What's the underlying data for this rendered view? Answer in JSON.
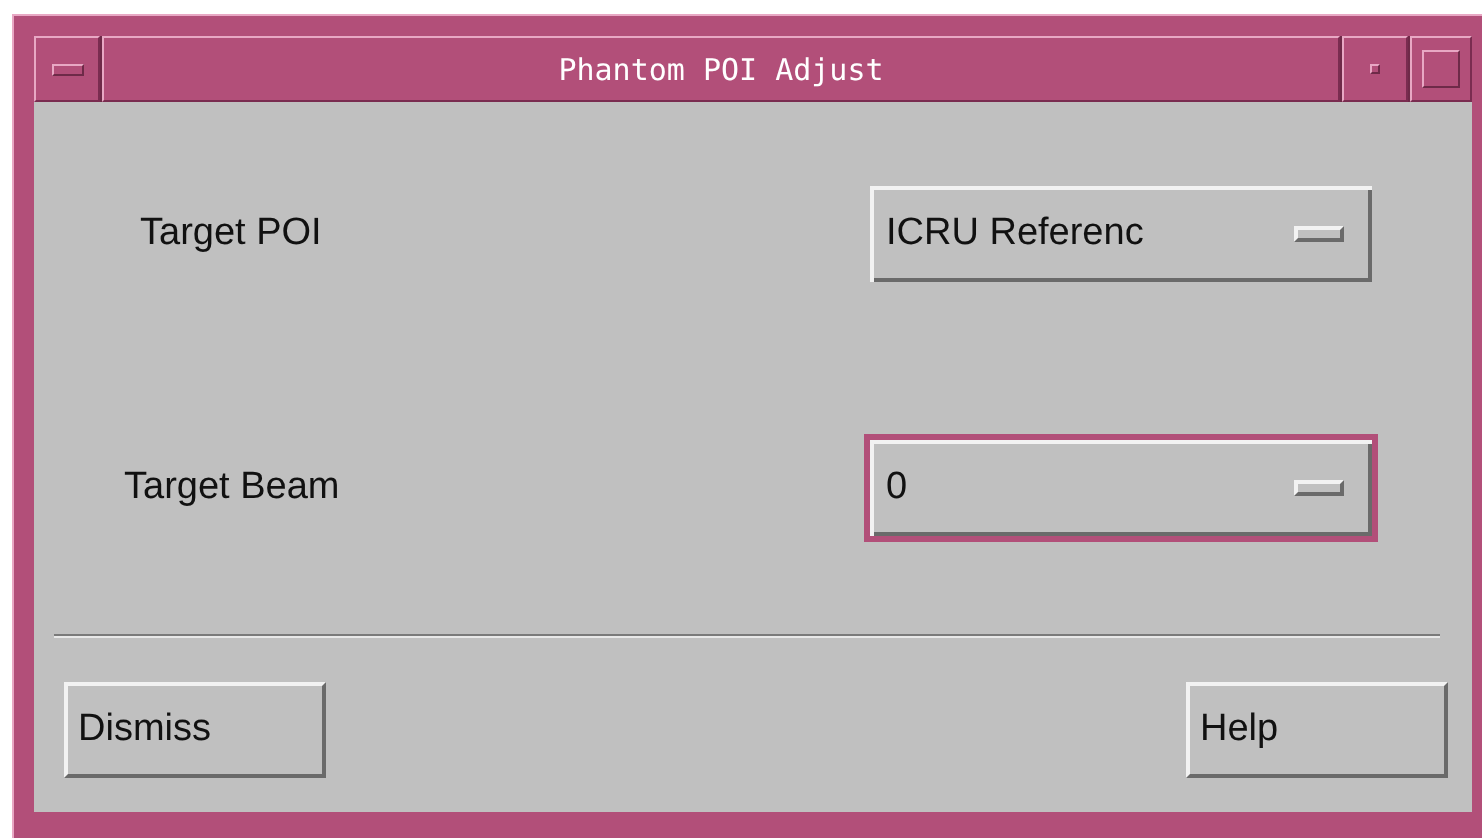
{
  "window": {
    "title": "Phantom POI Adjust"
  },
  "fields": [
    {
      "label": "Target POI",
      "value": "ICRU Referenc",
      "focused": false
    },
    {
      "label": "Target Beam",
      "value": "0",
      "focused": true
    }
  ],
  "buttons": [
    "Dismiss",
    "Help"
  ]
}
